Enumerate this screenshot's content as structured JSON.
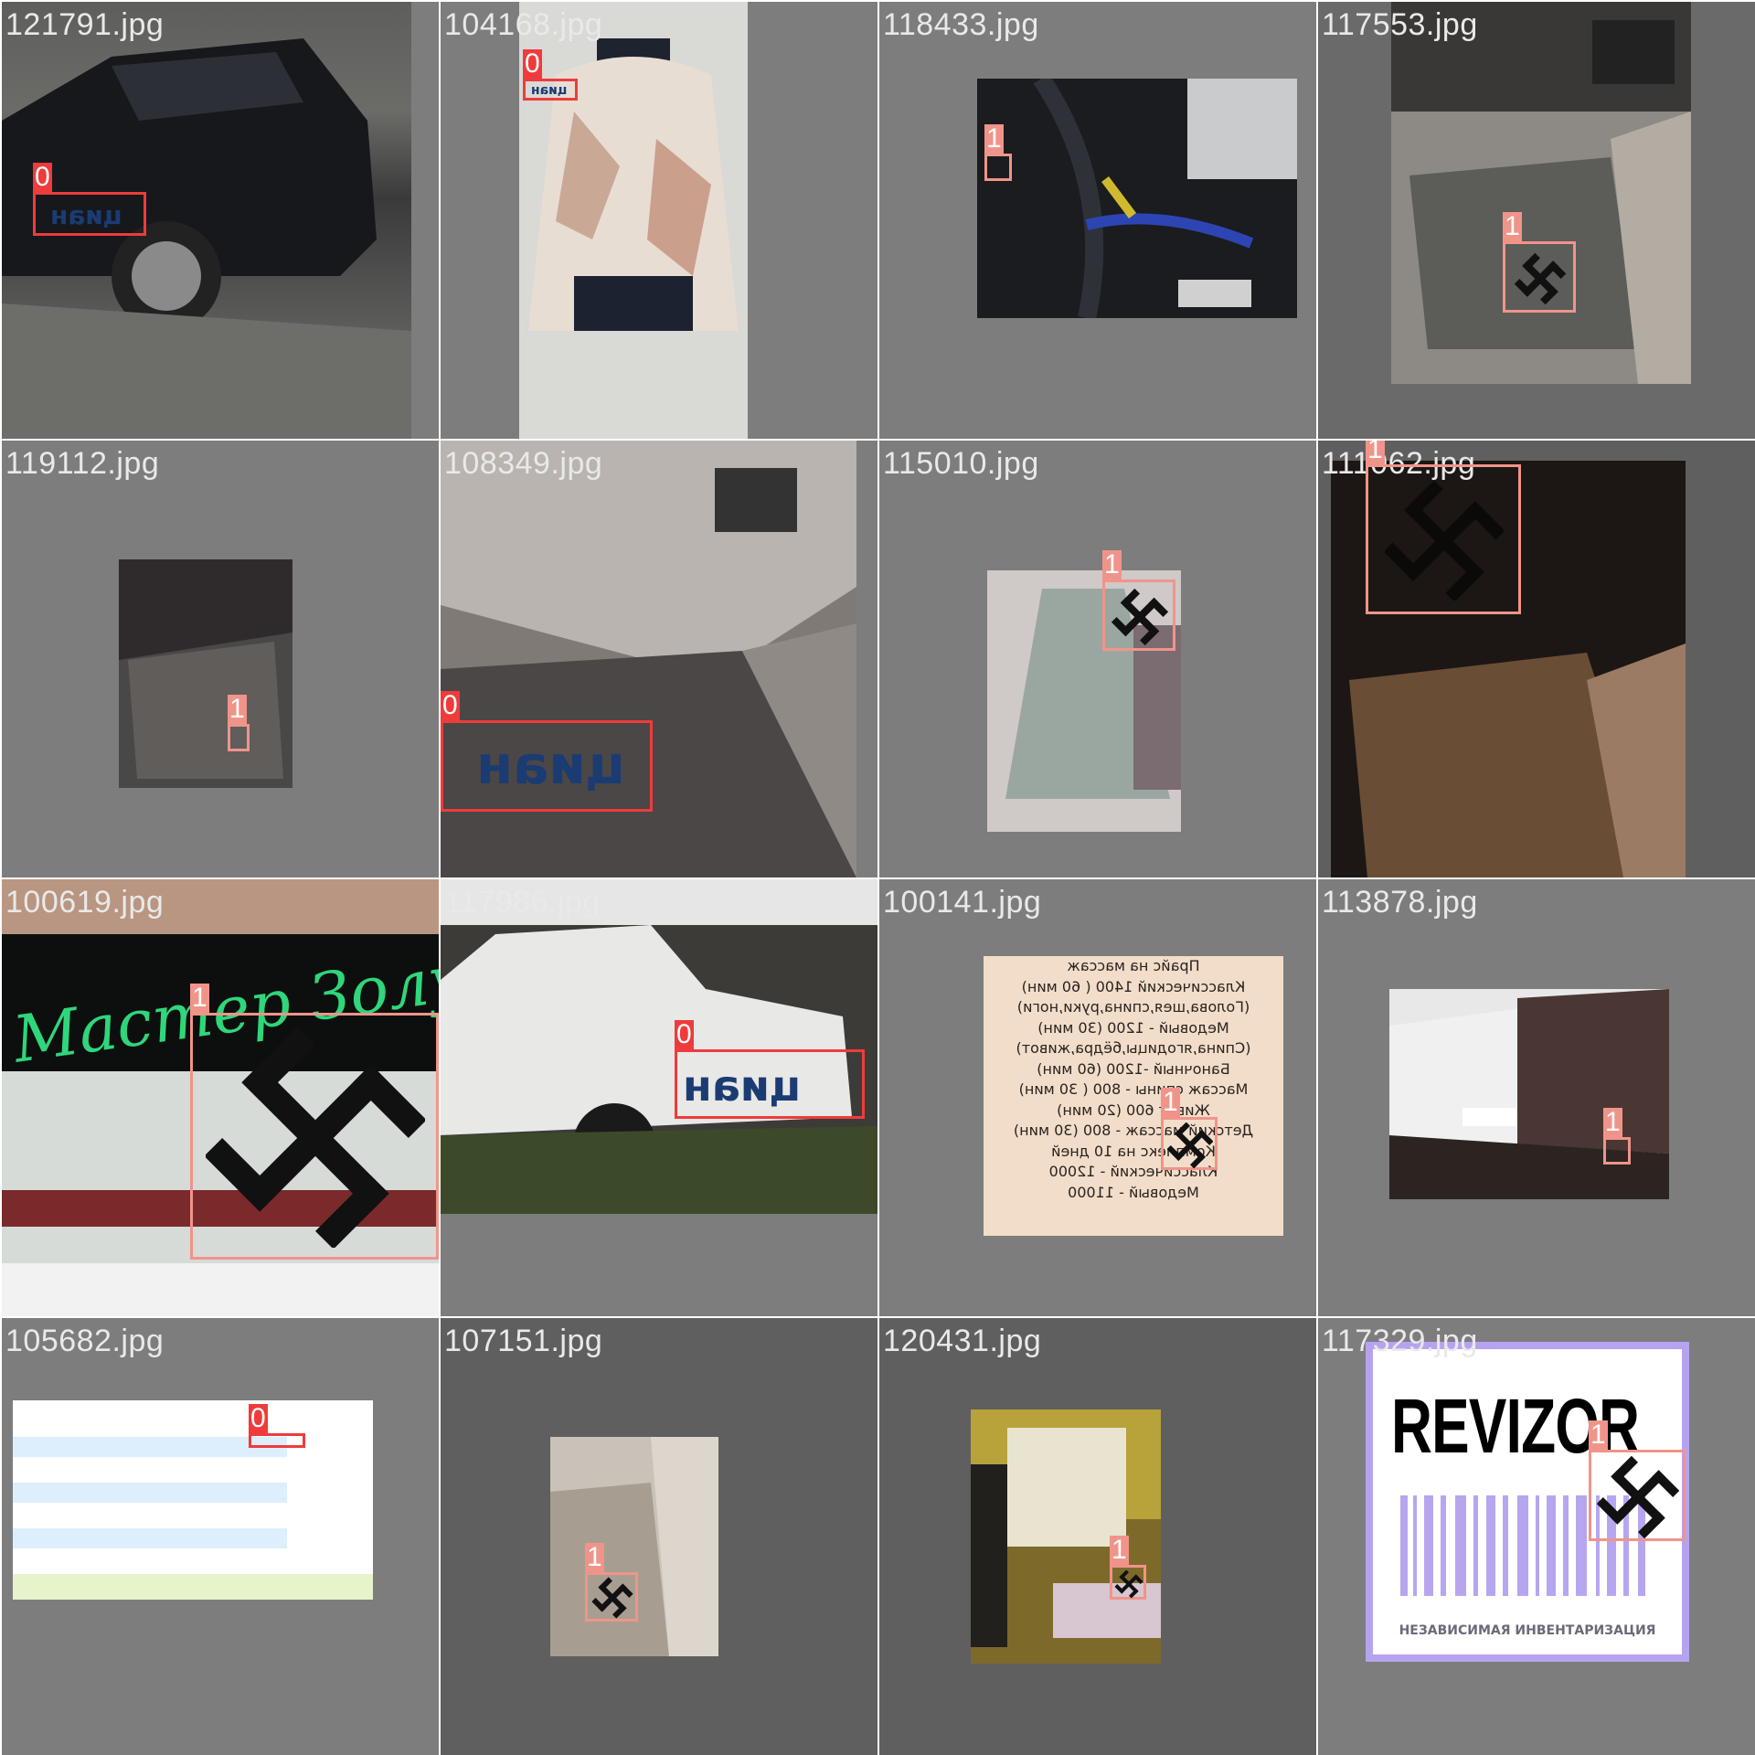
{
  "tiles": [
    {
      "filename": "121791.jpg",
      "boxes": [
        {
          "cls": "0",
          "text": "циан"
        }
      ]
    },
    {
      "filename": "104168.jpg",
      "boxes": [
        {
          "cls": "0",
          "text": "циан"
        }
      ]
    },
    {
      "filename": "118433.jpg",
      "boxes": [
        {
          "cls": "1"
        }
      ]
    },
    {
      "filename": "117553.jpg",
      "boxes": [
        {
          "cls": "1"
        }
      ]
    },
    {
      "filename": "119112.jpg",
      "boxes": [
        {
          "cls": "1"
        }
      ]
    },
    {
      "filename": "108349.jpg",
      "boxes": [
        {
          "cls": "0",
          "text": "циан"
        }
      ]
    },
    {
      "filename": "115010.jpg",
      "boxes": [
        {
          "cls": "1"
        }
      ]
    },
    {
      "filename": "111062.jpg",
      "boxes": [
        {
          "cls": "1"
        }
      ]
    },
    {
      "filename": "100619.jpg",
      "boxes": [
        {
          "cls": "1"
        }
      ],
      "sign_text": "Мастер Золушка"
    },
    {
      "filename": "117986.jpg",
      "boxes": [
        {
          "cls": "0",
          "text": "циан"
        }
      ]
    },
    {
      "filename": "100141.jpg",
      "boxes": [
        {
          "cls": "1"
        }
      ],
      "price_lines": [
        "Прайс на массаж",
        "Классический 1400 ( 60 мин)",
        "(Голова,шея,спина,руки,ноги)",
        "Медовый - 1200 (30 мин)",
        "(Спина,ягодицы,бёдра,живот)",
        "Баночный -1200 (60 мин)",
        "Массаж спины - 800 ( 30 мин)",
        "Живот 600 (20 мин)",
        "Детский массаж - 800 (30 мин)",
        "Комплекс на 10 дней",
        "Классический - 12000",
        "Медовый - 11000"
      ]
    },
    {
      "filename": "113878.jpg",
      "boxes": [
        {
          "cls": "1"
        }
      ]
    },
    {
      "filename": "105682.jpg",
      "boxes": [
        {
          "cls": "0"
        }
      ]
    },
    {
      "filename": "107151.jpg",
      "boxes": [
        {
          "cls": "1"
        }
      ]
    },
    {
      "filename": "120431.jpg",
      "boxes": [
        {
          "cls": "1"
        }
      ]
    },
    {
      "filename": "117329.jpg",
      "boxes": [
        {
          "cls": "1"
        }
      ],
      "logo_title": "REVIZOR",
      "logo_subtitle": "НЕЗАВИСИМАЯ ИНВЕНТАРИЗАЦИЯ"
    }
  ]
}
